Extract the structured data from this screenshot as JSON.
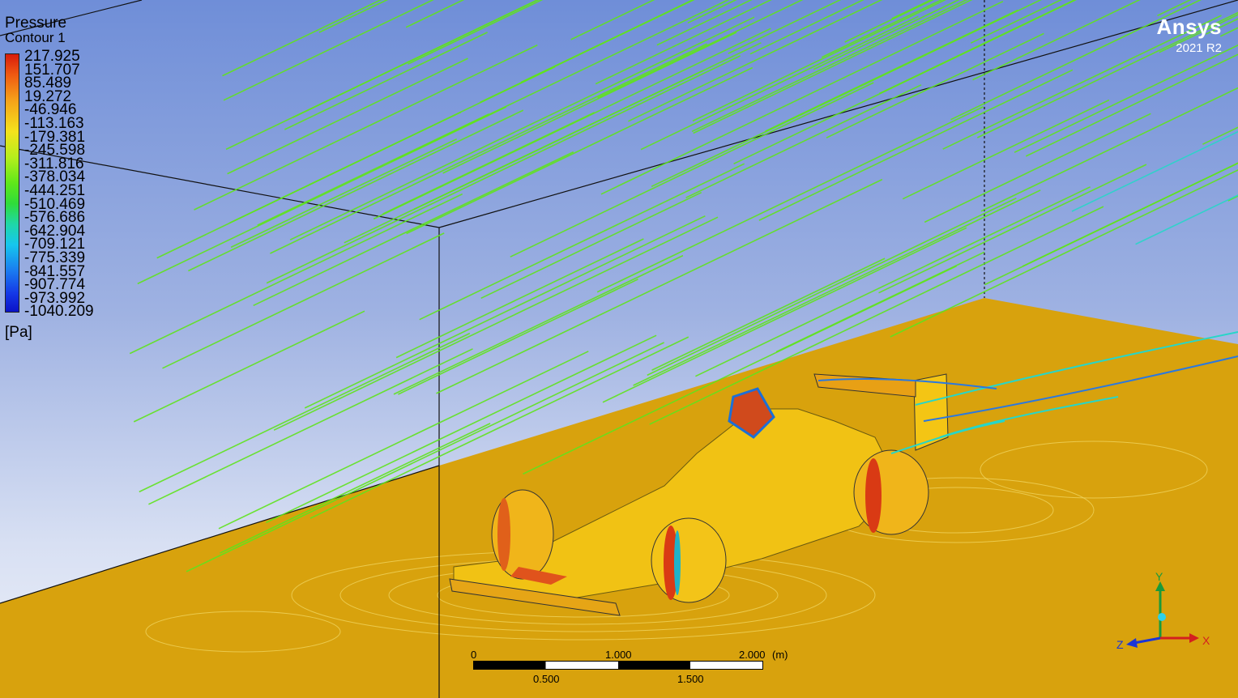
{
  "legend": {
    "title_line1": "Pressure",
    "title_line2": "Contour 1",
    "unit": "[Pa]",
    "values": [
      "217.925",
      "151.707",
      "85.489",
      "19.272",
      "-46.946",
      "-113.163",
      "-179.381",
      "-245.598",
      "-311.816",
      "-378.034",
      "-444.251",
      "-510.469",
      "-576.686",
      "-642.904",
      "-709.121",
      "-775.339",
      "-841.557",
      "-907.774",
      "-973.992",
      "-1040.209"
    ]
  },
  "brand": {
    "name": "Ansys",
    "version": "2021 R2"
  },
  "scale_bar": {
    "top_labels": [
      "0",
      "1.000",
      "2.000"
    ],
    "unit": "(m)",
    "bottom_labels": [
      "0.500",
      "1.500"
    ]
  },
  "axes": {
    "y": "Y",
    "x": "X",
    "z": "Z"
  },
  "colors": {
    "streamline_green": "#5fe31c",
    "streamline_cyan": "#27d6c8",
    "ground": "#d9a30c",
    "car_body": "#f2c313",
    "axis_x": "#d41f1f",
    "axis_y": "#1a9a3a",
    "axis_z": "#1a35d8"
  }
}
